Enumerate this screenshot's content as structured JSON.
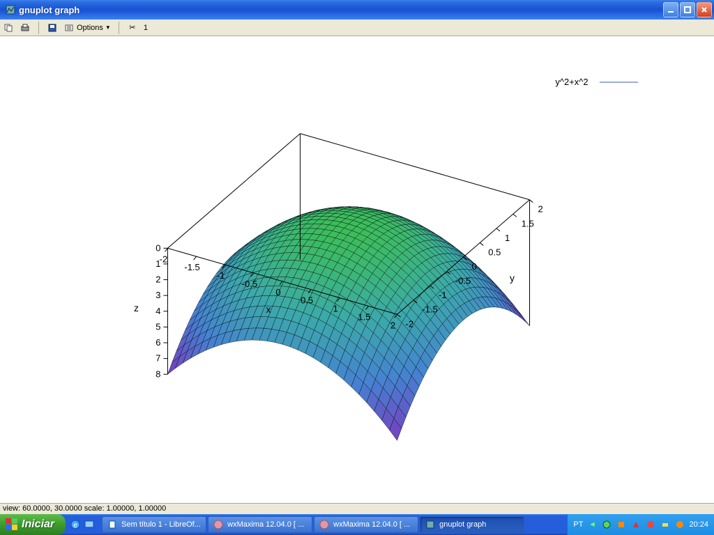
{
  "window": {
    "title": "gnuplot graph"
  },
  "toolbar": {
    "options_label": "Options",
    "number": "1"
  },
  "plot": {
    "legend": "y^2+x^2",
    "axis_z": "z",
    "axis_x": "x",
    "axis_y": "y",
    "z_ticks": [
      "0",
      "1",
      "2",
      "3",
      "4",
      "5",
      "6",
      "7",
      "8"
    ],
    "x_ticks": [
      "-2",
      "-1.5",
      "-1",
      "-0.5",
      "0",
      "0.5",
      "1",
      "1.5",
      "2"
    ],
    "y_ticks": [
      "-2",
      "-1.5",
      "-1",
      "-0.5",
      "0",
      "0.5",
      "1",
      "1.5",
      "2"
    ]
  },
  "status": {
    "text": "view: 60.0000, 30.0000  scale: 1.00000, 1.00000"
  },
  "taskbar": {
    "start": "Iniciar",
    "tasks": [
      "Sem título 1 - LibreOf...",
      "wxMaxima 12.04.0 [ ...",
      "wxMaxima 12.04.0 [ ...",
      "gnuplot graph"
    ],
    "lang": "PT",
    "clock": "20:24"
  },
  "chart_data": {
    "type": "surface3d",
    "function": "z = x^2 + y^2",
    "title": "y^2+x^2",
    "xlabel": "x",
    "ylabel": "y",
    "zlabel": "z",
    "xlim": [
      -2,
      2
    ],
    "ylim": [
      -2,
      2
    ],
    "zlim": [
      0,
      8
    ],
    "x_ticks": [
      -2,
      -1.5,
      -1,
      -0.5,
      0,
      0.5,
      1,
      1.5,
      2
    ],
    "y_ticks": [
      -2,
      -1.5,
      -1,
      -0.5,
      0,
      0.5,
      1,
      1.5,
      2
    ],
    "z_ticks": [
      0,
      1,
      2,
      3,
      4,
      5,
      6,
      7,
      8
    ],
    "view": {
      "rot_x": 60.0,
      "rot_z": 30.0
    },
    "scale": [
      1.0,
      1.0
    ],
    "grid_resolution": 30,
    "colormap_hint": "blue-green (low z green, high z blue/purple)"
  }
}
